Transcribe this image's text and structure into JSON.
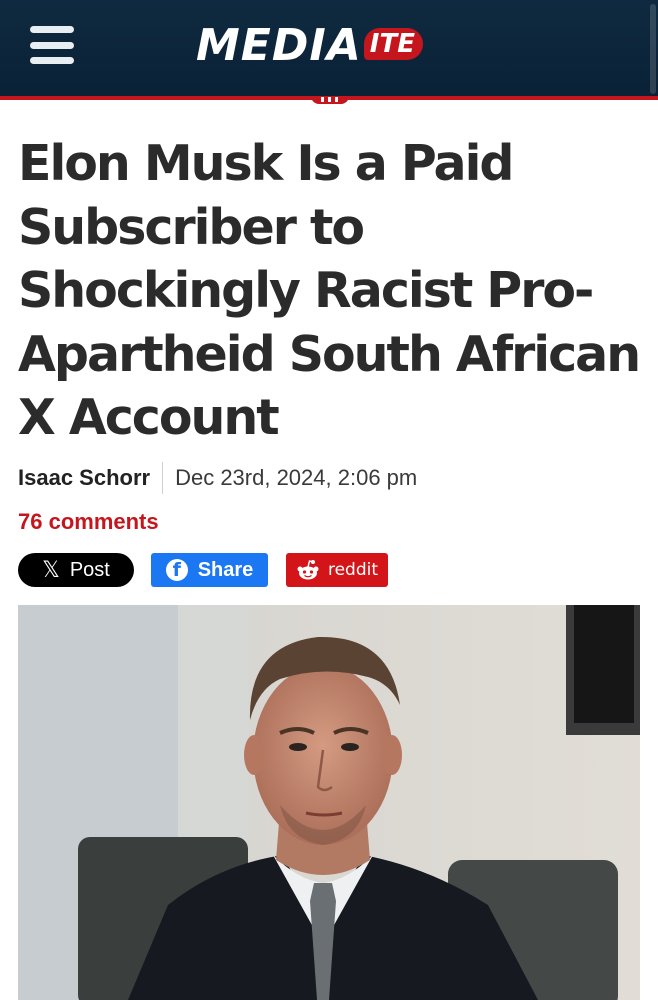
{
  "header": {
    "logo_main": "MEDIA",
    "logo_badge": "ITE",
    "menu_icon": "hamburger-menu-icon",
    "colors": {
      "bar": "#0f2a40",
      "accent": "#c4161c"
    }
  },
  "article": {
    "headline": "Elon Musk Is a Paid Subscriber to Shockingly Racist Pro-Apartheid South African X Account",
    "author": "Isaac Schorr",
    "date": "Dec 23rd, 2024, 2:06 pm",
    "comments": "76 comments"
  },
  "share": {
    "x_label": "Post",
    "x_icon": "x-logo-icon",
    "facebook_label": "Share",
    "facebook_icon": "facebook-icon",
    "reddit_label": "reddit",
    "reddit_icon": "reddit-alien-icon"
  }
}
